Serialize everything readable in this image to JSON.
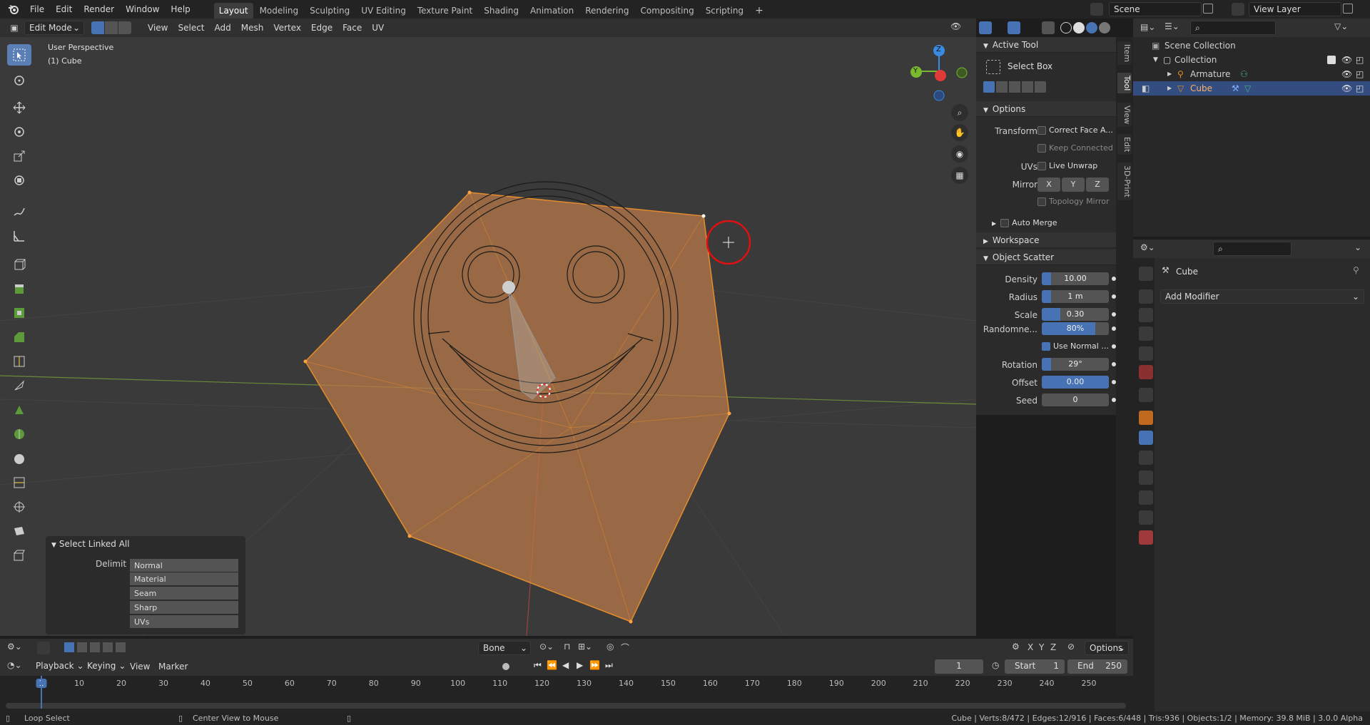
{
  "app": {
    "menus": [
      "File",
      "Edit",
      "Render",
      "Window",
      "Help"
    ],
    "workspaces": [
      "Layout",
      "Modeling",
      "Sculpting",
      "UV Editing",
      "Texture Paint",
      "Shading",
      "Animation",
      "Rendering",
      "Compositing",
      "Scripting"
    ],
    "active_workspace": "Layout",
    "add_tab": "+",
    "scene": "Scene",
    "view_layer": "View Layer"
  },
  "viewport_header": {
    "mode": "Edit Mode",
    "menus": [
      "View",
      "Select",
      "Add",
      "Mesh",
      "Vertex",
      "Edge",
      "Face",
      "UV"
    ]
  },
  "viewport": {
    "perspective": "User Perspective",
    "object": "(1) Cube",
    "gizmo": {
      "z": "Z",
      "y": "Y"
    }
  },
  "npanel": {
    "active_tool_title": "Active Tool",
    "tool_name": "Select Box",
    "options_title": "Options",
    "transform_label": "Transform",
    "correct_face": "Correct Face A...",
    "keep_connected": "Keep Connected",
    "uvs_label": "UVs",
    "live_unwrap": "Live Unwrap",
    "mirror_label": "Mirror",
    "mirror_axes": [
      "X",
      "Y",
      "Z"
    ],
    "topology_mirror": "Topology Mirror",
    "auto_merge": "Auto Merge",
    "workspace_title": "Workspace",
    "scatter_title": "Object Scatter",
    "density_label": "Density",
    "density": "10.00",
    "radius_label": "Radius",
    "radius": "1 m",
    "scale_label": "Scale",
    "scale": "0.30",
    "random_label": "Randomne...",
    "random": "80%",
    "random_frac": 0.8,
    "use_normal": "Use Normal ...",
    "rotation_label": "Rotation",
    "rotation": "29°",
    "offset_label": "Offset",
    "offset": "0.00",
    "seed_label": "Seed",
    "seed": "0"
  },
  "sidetabs": [
    "Item",
    "Tool",
    "View",
    "Edit",
    "3D-Print"
  ],
  "outliner": {
    "scene_collection": "Scene Collection",
    "collection": "Collection",
    "armature": "Armature",
    "cube": "Cube"
  },
  "properties": {
    "object_name": "Cube",
    "add_modifier": "Add Modifier"
  },
  "operator_panel": {
    "title": "Select Linked All",
    "delimit_label": "Delimit",
    "options": [
      "Normal",
      "Material",
      "Seam",
      "Sharp",
      "UVs"
    ]
  },
  "viewport_footer": {
    "bone": "Bone",
    "axes": [
      "X",
      "Y",
      "Z"
    ],
    "options": "Options"
  },
  "timeline": {
    "menus": [
      "Playback",
      "Keying",
      "View",
      "Marker"
    ],
    "current_frame": "1",
    "start_label": "Start",
    "start": "1",
    "end_label": "End",
    "end": "250",
    "ticks": [
      "1",
      "10",
      "20",
      "30",
      "40",
      "50",
      "60",
      "70",
      "80",
      "90",
      "100",
      "110",
      "120",
      "130",
      "140",
      "150",
      "160",
      "170",
      "180",
      "190",
      "200",
      "210",
      "220",
      "230",
      "240",
      "250"
    ]
  },
  "status": {
    "left": "Loop Select",
    "middle": "Center View to Mouse",
    "right": "Cube | Verts:8/472 | Edges:12/916 | Faces:6/448 | Tris:936 | Objects:1/2 | Memory: 39.8 MiB | 3.0.0 Alpha"
  },
  "colors": {
    "accent": "#4772b3",
    "selection": "#e38c2c",
    "active_tab": "#3d3d3d"
  }
}
